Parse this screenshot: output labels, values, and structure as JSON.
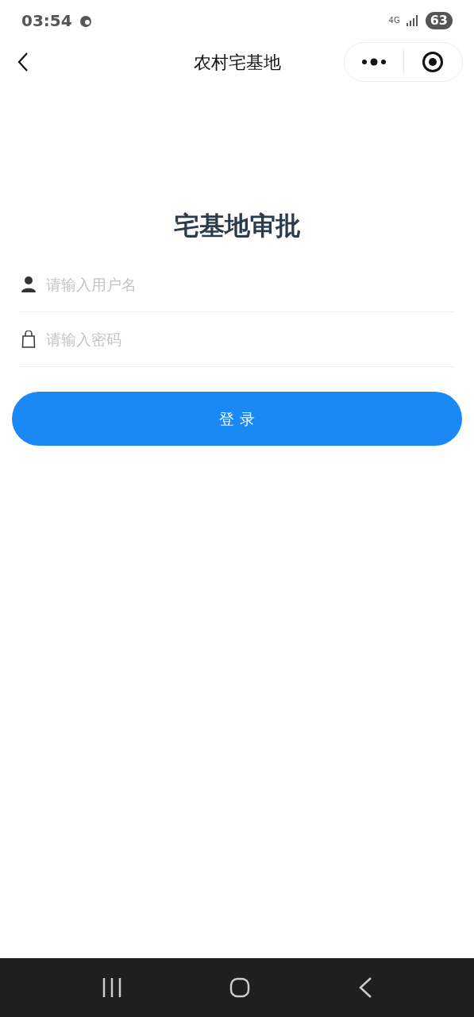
{
  "status_bar": {
    "time": "03:54",
    "network": "4G",
    "battery": "63"
  },
  "header": {
    "title": "农村宅基地"
  },
  "login": {
    "heading": "宅基地审批",
    "fields": [
      {
        "kind": "user",
        "placeholder": "请输入用户名"
      },
      {
        "kind": "password",
        "placeholder": "请输入密码"
      }
    ],
    "submit": "登 录"
  }
}
